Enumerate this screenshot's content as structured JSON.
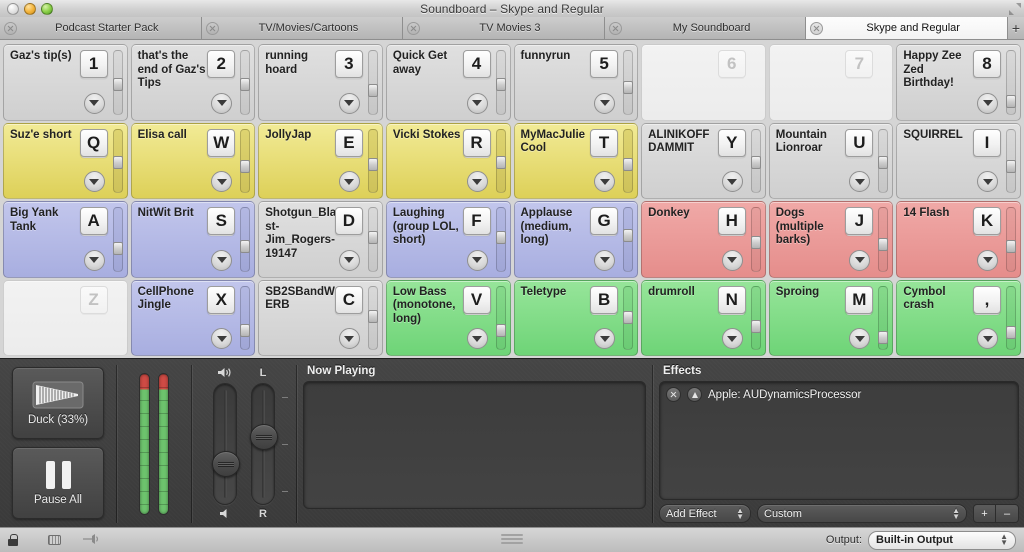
{
  "window": {
    "title": "Soundboard – Skype and Regular",
    "traffic_lights": [
      "close",
      "minimize",
      "zoom"
    ]
  },
  "tabs": {
    "items": [
      {
        "label": "Podcast Starter Pack",
        "active": false
      },
      {
        "label": "TV/Movies/Cartoons",
        "active": false
      },
      {
        "label": "TV Movies 3",
        "active": false
      },
      {
        "label": "My Soundboard",
        "active": false
      },
      {
        "label": "Skype and Regular",
        "active": true
      }
    ],
    "add_label": "+"
  },
  "grid": {
    "rows": [
      [
        {
          "label": "Gaz's tip(s)",
          "key": "1",
          "color": "gray",
          "empty": false,
          "fader": 55
        },
        {
          "label": "that's the end of Gaz's Tips",
          "key": "2",
          "color": "gray",
          "empty": false,
          "fader": 55
        },
        {
          "label": "running hoard",
          "key": "3",
          "color": "gray",
          "empty": false,
          "fader": 42
        },
        {
          "label": "Quick Get away",
          "key": "4",
          "color": "gray",
          "empty": false,
          "fader": 55
        },
        {
          "label": "funnyrun",
          "key": "5",
          "color": "gray",
          "empty": false,
          "fader": 48
        },
        {
          "label": "",
          "key": "6",
          "color": "empty",
          "empty": true,
          "fader": 0
        },
        {
          "label": "",
          "key": "7",
          "color": "empty",
          "empty": true,
          "fader": 0
        },
        {
          "label": "Happy Zee Zed Birthday!",
          "key": "8",
          "color": "gray",
          "empty": false,
          "fader": 20
        }
      ],
      [
        {
          "label": "Suz'e short",
          "key": "Q",
          "color": "yellow",
          "empty": false,
          "fader": 55
        },
        {
          "label": "Elisa call",
          "key": "W",
          "color": "yellow",
          "empty": false,
          "fader": 48
        },
        {
          "label": "JollyJap",
          "key": "E",
          "color": "yellow",
          "empty": false,
          "fader": 52
        },
        {
          "label": "Vicki Stokes",
          "key": "R",
          "color": "yellow",
          "empty": false,
          "fader": 55
        },
        {
          "label": "MyMacJulieCool",
          "key": "T",
          "color": "yellow",
          "empty": false,
          "fader": 52
        },
        {
          "label": "ALINIKOFF DAMMIT",
          "key": "Y",
          "color": "gray",
          "empty": false,
          "fader": 55
        },
        {
          "label": "Mountain Lionroar",
          "key": "U",
          "color": "gray",
          "empty": false,
          "fader": 55
        },
        {
          "label": "SQUIRREL",
          "key": "I",
          "color": "gray",
          "empty": false,
          "fader": 48
        }
      ],
      [
        {
          "label": "Big Yank Tank",
          "key": "A",
          "color": "purple",
          "empty": false,
          "fader": 40
        },
        {
          "label": "NitWit Brit",
          "key": "S",
          "color": "purple",
          "empty": false,
          "fader": 44
        },
        {
          "label": "Shotgun_Blast-Jim_Rogers-19147",
          "key": "D",
          "color": "gray",
          "empty": false,
          "fader": 62
        },
        {
          "label": "Laughing (group LOL, short)",
          "key": "F",
          "color": "purple",
          "empty": false,
          "fader": 62
        },
        {
          "label": "Applause (medium, long)",
          "key": "G",
          "color": "purple",
          "empty": false,
          "fader": 66
        },
        {
          "label": "Donkey",
          "key": "H",
          "color": "red",
          "empty": false,
          "fader": 52
        },
        {
          "label": "Dogs (multiple barks)",
          "key": "J",
          "color": "red",
          "empty": false,
          "fader": 48
        },
        {
          "label": "14 Flash",
          "key": "K",
          "color": "red",
          "empty": false,
          "fader": 44
        }
      ],
      [
        {
          "label": "",
          "key": "Z",
          "color": "empty",
          "empty": true,
          "fader": 0
        },
        {
          "label": "CellPhone Jingle",
          "key": "X",
          "color": "purple",
          "empty": false,
          "fader": 34
        },
        {
          "label": "SB2SBandWERB",
          "key": "C",
          "color": "gray",
          "empty": false,
          "fader": 62
        },
        {
          "label": "Low Bass (monotone, long)",
          "key": "V",
          "color": "green",
          "empty": false,
          "fader": 34
        },
        {
          "label": "Teletype",
          "key": "B",
          "color": "green",
          "empty": false,
          "fader": 60
        },
        {
          "label": "drumroll",
          "key": "N",
          "color": "green",
          "empty": false,
          "fader": 42
        },
        {
          "label": "Sproing",
          "key": "M",
          "color": "green",
          "empty": false,
          "fader": 20
        },
        {
          "label": "Cymbol crash",
          "key": ",",
          "color": "green",
          "empty": false,
          "fader": 30
        }
      ]
    ]
  },
  "transport": {
    "duck_label": "Duck (33%)",
    "pause_label": "Pause All"
  },
  "sliders": {
    "volume_top_icon": "speaker-loud-icon",
    "volume_bottom_icon": "speaker-quiet-icon",
    "pan_top_label": "L",
    "pan_bottom_label": "R",
    "volume_value": 30,
    "pan_value": 58
  },
  "now_playing": {
    "title": "Now Playing",
    "items": []
  },
  "effects": {
    "title": "Effects",
    "items": [
      {
        "name": "Apple: AUDynamicsProcessor"
      }
    ],
    "add_effect_label": "Add Effect",
    "preset_label": "Custom",
    "plus_label": "+",
    "minus_label": "–"
  },
  "statusbar": {
    "lock_icon": "lock-icon",
    "grid_icon": "grid-view-icon",
    "keyboard_icon": "keyboard-icon",
    "volume_icon": "volume-icon",
    "output_label": "Output:",
    "output_device": "Built-in Output"
  },
  "colors": {
    "yellow": "#e4d96a",
    "purple": "#b2b8e4",
    "red": "#e99694",
    "green": "#7ed986",
    "gray": "#d6d6d6",
    "dark_panel": "#3e3e3e"
  }
}
